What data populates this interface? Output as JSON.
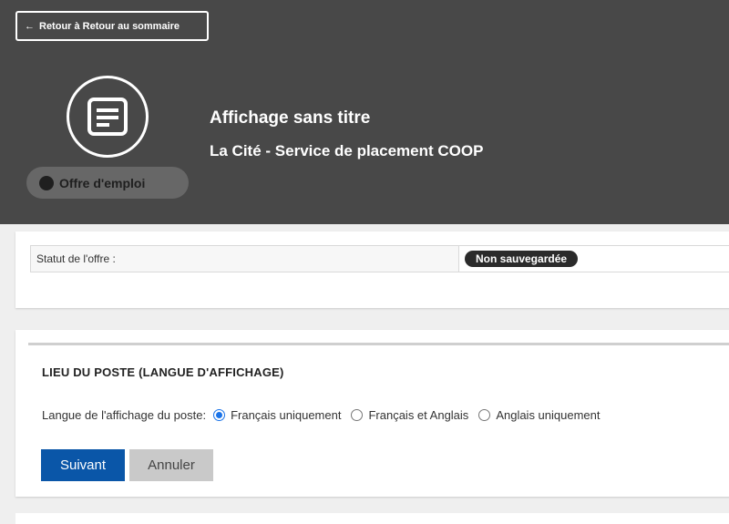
{
  "header": {
    "back_label": "Retour à Retour au sommaire",
    "title": "Affichage sans titre",
    "subtitle": "La Cité - Service de placement COOP",
    "type_label": "Offre d'emploi",
    "icon": "document-icon",
    "background_color": "#484848"
  },
  "status": {
    "label": "Statut de l'offre :",
    "value": "Non sauvegardée"
  },
  "location": {
    "title": "LIEU DU POSTE (LANGUE D'AFFICHAGE)",
    "language_label": "Langue de l'affichage du poste:",
    "options": [
      {
        "label": "Français uniquement",
        "selected": true
      },
      {
        "label": "Français et Anglais",
        "selected": false
      },
      {
        "label": "Anglais uniquement",
        "selected": false
      }
    ]
  },
  "buttons": {
    "next_label": "Suivant",
    "cancel_label": "Annuler",
    "primary_color": "#0a56a8"
  }
}
